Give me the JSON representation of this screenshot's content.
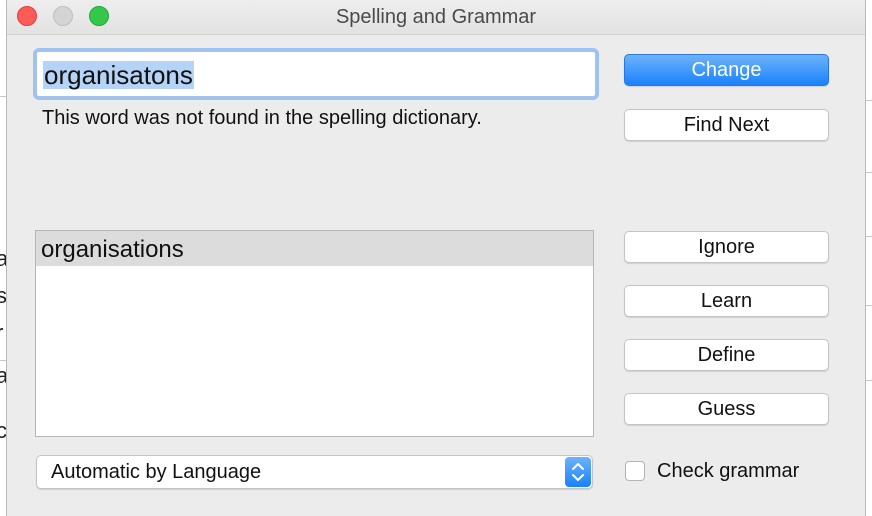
{
  "window": {
    "title": "Spelling and Grammar",
    "traffic_lights": [
      "close",
      "minimize",
      "zoom"
    ]
  },
  "misspelled_word": "organisatons",
  "message": "This word was not found in the spelling dictionary.",
  "suggestions": [
    "organisations"
  ],
  "buttons": {
    "change": "Change",
    "find_next": "Find Next",
    "ignore": "Ignore",
    "learn": "Learn",
    "define": "Define",
    "guess": "Guess"
  },
  "language_select": {
    "value": "Automatic by Language"
  },
  "check_grammar": {
    "label": "Check grammar",
    "checked": false
  },
  "colors": {
    "primary_button": "#1a82fb",
    "selection": "#b5d3f7",
    "focus_ring": "#9ec2f2"
  }
}
